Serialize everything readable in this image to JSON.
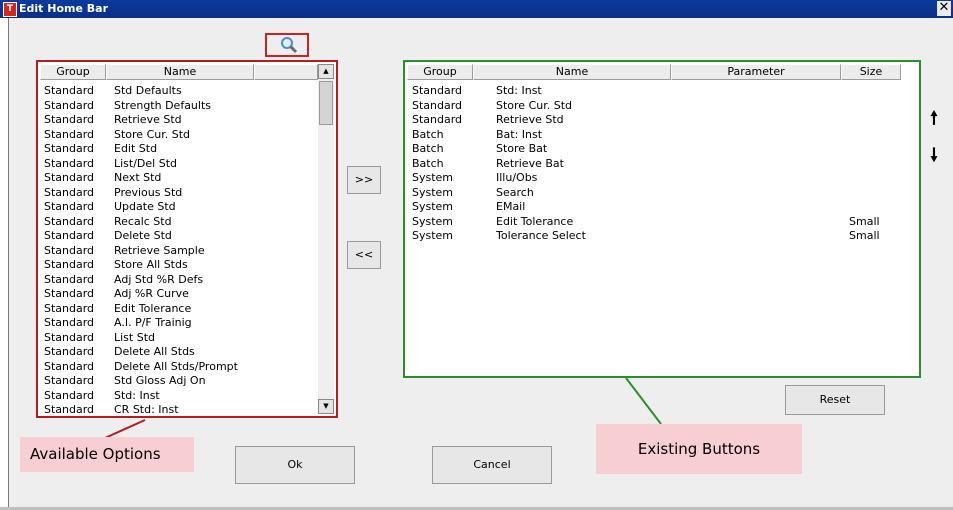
{
  "window": {
    "title": "Edit Home Bar",
    "app_icon_letter": "T",
    "close_glyph": "✕"
  },
  "search_icon": "magnifier-icon",
  "available": {
    "headers": [
      "Group",
      "Name"
    ],
    "rows": [
      [
        "Standard",
        "Std Defaults"
      ],
      [
        "Standard",
        "Strength Defaults"
      ],
      [
        "Standard",
        "Retrieve Std"
      ],
      [
        "Standard",
        "Store Cur. Std"
      ],
      [
        "Standard",
        "Edit Std"
      ],
      [
        "Standard",
        "List/Del Std"
      ],
      [
        "Standard",
        "Next Std"
      ],
      [
        "Standard",
        "Previous Std"
      ],
      [
        "Standard",
        "Update Std"
      ],
      [
        "Standard",
        "Recalc Std"
      ],
      [
        "Standard",
        "Delete Std"
      ],
      [
        "Standard",
        "Retrieve Sample"
      ],
      [
        "Standard",
        "Store All Stds"
      ],
      [
        "Standard",
        "Adj Std %R Defs"
      ],
      [
        "Standard",
        "Adj %R Curve"
      ],
      [
        "Standard",
        "Edit Tolerance"
      ],
      [
        "Standard",
        "A.I. P/F Trainig"
      ],
      [
        "Standard",
        "List Std"
      ],
      [
        "Standard",
        "Delete All Stds"
      ],
      [
        "Standard",
        "Delete All Stds/Prompt"
      ],
      [
        "Standard",
        "Std Gloss Adj On"
      ],
      [
        "Standard",
        "Std: Inst"
      ],
      [
        "Standard",
        "CR Std: Inst"
      ]
    ]
  },
  "existing": {
    "headers": [
      "Group",
      "Name",
      "Parameter",
      "Size"
    ],
    "rows": [
      [
        "Standard",
        "Std: Inst",
        "",
        ""
      ],
      [
        "Standard",
        "Store Cur. Std",
        "",
        ""
      ],
      [
        "Standard",
        "Retrieve Std",
        "",
        ""
      ],
      [
        "Batch",
        "Bat: Inst",
        "",
        ""
      ],
      [
        "Batch",
        "Store Bat",
        "",
        ""
      ],
      [
        "Batch",
        "Retrieve Bat",
        "",
        ""
      ],
      [
        "System",
        "Illu/Obs",
        "",
        ""
      ],
      [
        "System",
        "Search",
        "",
        ""
      ],
      [
        "System",
        "EMail",
        "",
        ""
      ],
      [
        "System",
        "Edit Tolerance",
        "",
        "Small"
      ],
      [
        "System",
        "Tolerance Select",
        "",
        "Small"
      ]
    ]
  },
  "buttons": {
    "add": ">>",
    "remove": "<<",
    "reset": "Reset",
    "ok": "Ok",
    "cancel": "Cancel"
  },
  "move_arrows": {
    "up": "🠕",
    "down": "🠗"
  },
  "callouts": {
    "available": "Available Options",
    "existing": "Existing Buttons"
  },
  "colors": {
    "available_border": "#b31d1d",
    "existing_border": "#2a8f2a",
    "callout_bg": "#f7cfd3",
    "titlebar": "#0a2f86"
  }
}
